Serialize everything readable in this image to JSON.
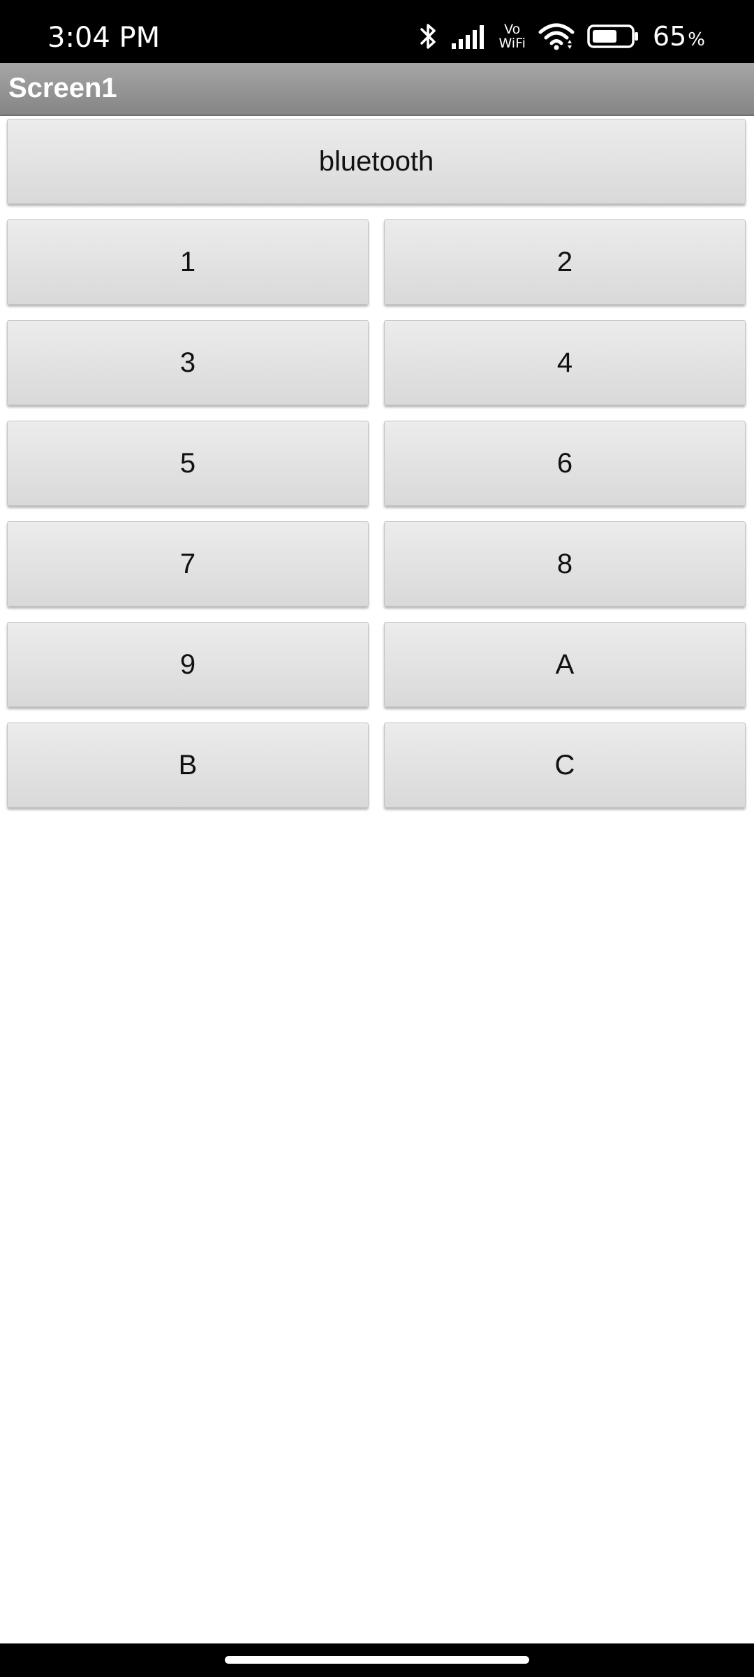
{
  "status_bar": {
    "time": "3:04 PM",
    "vowifi_top": "Vo",
    "vowifi_bottom": "WiFi",
    "battery_percent": "65",
    "battery_percent_sign": "%",
    "battery_level": 0.65,
    "icons": [
      "bluetooth-icon",
      "signal-bars-icon",
      "vowifi-icon",
      "wifi-icon",
      "battery-icon"
    ]
  },
  "app": {
    "title": "Screen1",
    "title_bar_color": "#8f8f8f"
  },
  "buttons": {
    "bluetooth": "bluetooth",
    "b1": "1",
    "b2": "2",
    "b3": "3",
    "b4": "4",
    "b5": "5",
    "b6": "6",
    "b7": "7",
    "b8": "8",
    "b9": "9",
    "bA": "A",
    "bB": "B",
    "bC": "C"
  }
}
